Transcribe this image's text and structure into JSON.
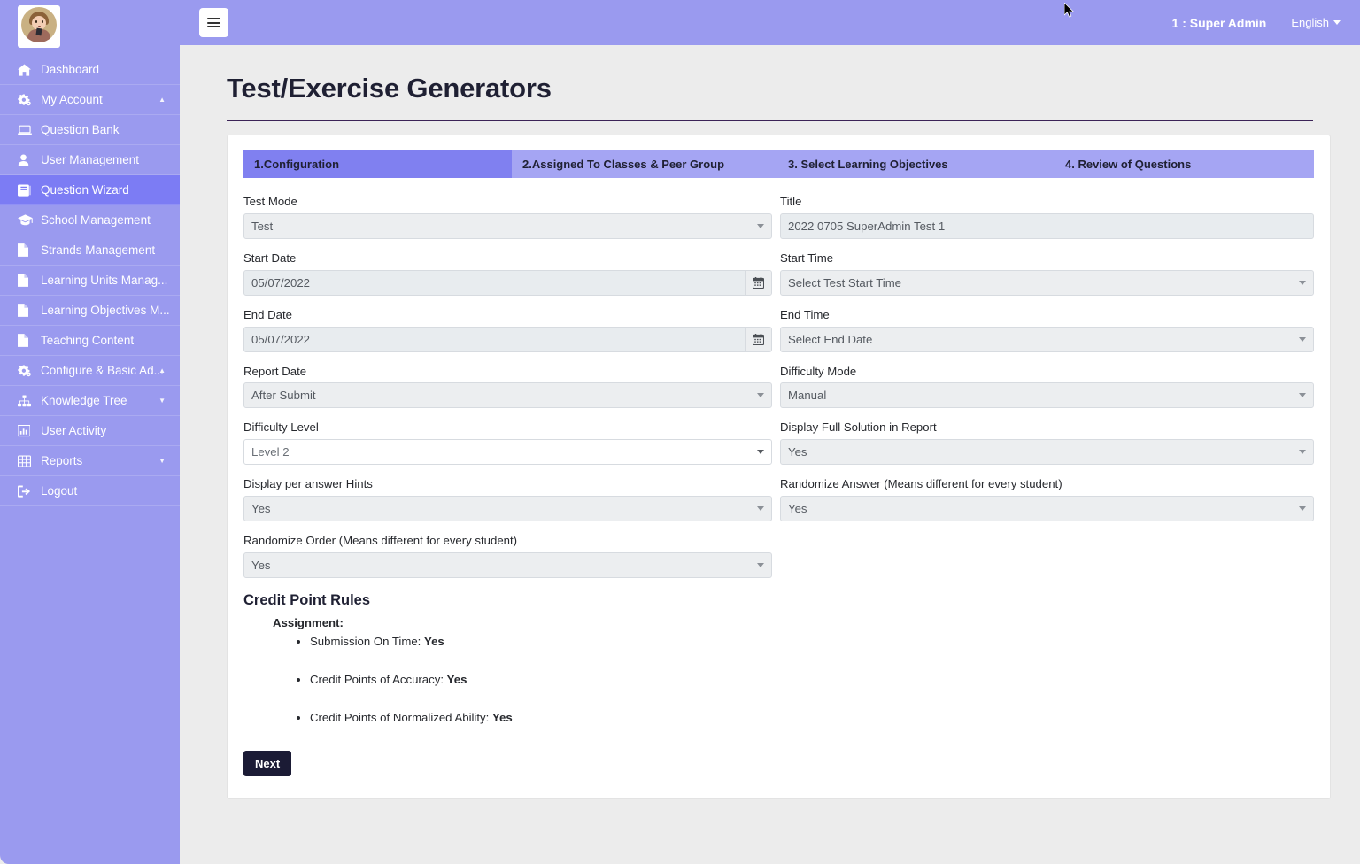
{
  "app": {
    "user_label": "1 : Super Admin",
    "language": "English",
    "hamburger_icon": "hamburger-menu-icon",
    "avatar_icon": "user-avatar"
  },
  "sidebar": {
    "items": [
      {
        "label": "Dashboard",
        "icon": "home-icon",
        "caret": "",
        "active": false
      },
      {
        "label": "My Account",
        "icon": "gears-icon",
        "caret": "▲",
        "active": false
      },
      {
        "label": "Question Bank",
        "icon": "laptop-icon",
        "caret": "",
        "active": false
      },
      {
        "label": "User Management",
        "icon": "user-icon",
        "caret": "",
        "active": false
      },
      {
        "label": "Question Wizard",
        "icon": "book-icon",
        "caret": "",
        "active": true
      },
      {
        "label": "School Management",
        "icon": "graduation-cap-icon",
        "caret": "",
        "active": false
      },
      {
        "label": "Strands Management",
        "icon": "file-icon",
        "caret": "",
        "active": false
      },
      {
        "label": "Learning Units Manag...",
        "icon": "file-icon",
        "caret": "",
        "active": false
      },
      {
        "label": "Learning Objectives M...",
        "icon": "file-icon",
        "caret": "",
        "active": false
      },
      {
        "label": "Teaching Content",
        "icon": "file-icon",
        "caret": "",
        "active": false
      },
      {
        "label": "Configure & Basic Ad...",
        "icon": "gears-icon",
        "caret": "▲",
        "active": false
      },
      {
        "label": "Knowledge Tree",
        "icon": "sitemap-icon",
        "caret": "▼",
        "active": false
      },
      {
        "label": "User Activity",
        "icon": "bar-chart-icon",
        "caret": "",
        "active": false
      },
      {
        "label": "Reports",
        "icon": "table-icon",
        "caret": "▼",
        "active": false
      },
      {
        "label": "Logout",
        "icon": "sign-out-icon",
        "caret": "",
        "active": false
      }
    ]
  },
  "page": {
    "title": "Test/Exercise Generators"
  },
  "wizard": {
    "tabs": [
      {
        "label": "1.Configuration",
        "active": true
      },
      {
        "label": "2.Assigned To Classes & Peer Group",
        "active": false
      },
      {
        "label": "3. Select Learning Objectives",
        "active": false
      },
      {
        "label": "4. Review of Questions",
        "active": false
      }
    ]
  },
  "form": {
    "test_mode": {
      "label": "Test Mode",
      "value": "Test"
    },
    "title": {
      "label": "Title",
      "value": "2022 0705 SuperAdmin Test 1",
      "placeholder": "Title"
    },
    "start_date": {
      "label": "Start Date",
      "value": "05/07/2022",
      "icon": "calendar-icon"
    },
    "start_time": {
      "label": "Start Time",
      "value": "Select Test Start Time"
    },
    "end_date": {
      "label": "End Date",
      "value": "05/07/2022",
      "icon": "calendar-icon"
    },
    "end_time": {
      "label": "End Time",
      "value": "Select End Date"
    },
    "report_date": {
      "label": "Report Date",
      "value": "After Submit"
    },
    "difficulty_mode": {
      "label": "Difficulty Mode",
      "value": "Manual"
    },
    "difficulty_level": {
      "label": "Difficulty Level",
      "value": "Level 2"
    },
    "display_full_solution": {
      "label": "Display Full Solution in Report",
      "value": "Yes"
    },
    "display_hints": {
      "label": "Display per answer Hints",
      "value": "Yes"
    },
    "randomize_answer": {
      "label": "Randomize Answer (Means different for every student)",
      "value": "Yes"
    },
    "randomize_order": {
      "label": "Randomize Order (Means different for every student)",
      "value": "Yes"
    }
  },
  "credit_rules": {
    "title": "Credit Point Rules",
    "subtitle": "Assignment:",
    "items": [
      {
        "label": "Submission On Time:",
        "value": "Yes"
      },
      {
        "label": "Credit Points of Accuracy:",
        "value": "Yes"
      },
      {
        "label": "Credit Points of Normalized Ability:",
        "value": "Yes"
      }
    ]
  },
  "actions": {
    "next_label": "Next"
  },
  "colors": {
    "sidebar": "#9a9aef",
    "sidebar_active": "#7c7cf4",
    "topbar": "#9a9aef",
    "tab_bar": "#a5a5f3",
    "tab_active": "#8080f0",
    "page_bg": "#ececec",
    "card_bg": "#ffffff",
    "button_dark": "#1b1b35",
    "title_rule": "#3b2357"
  }
}
